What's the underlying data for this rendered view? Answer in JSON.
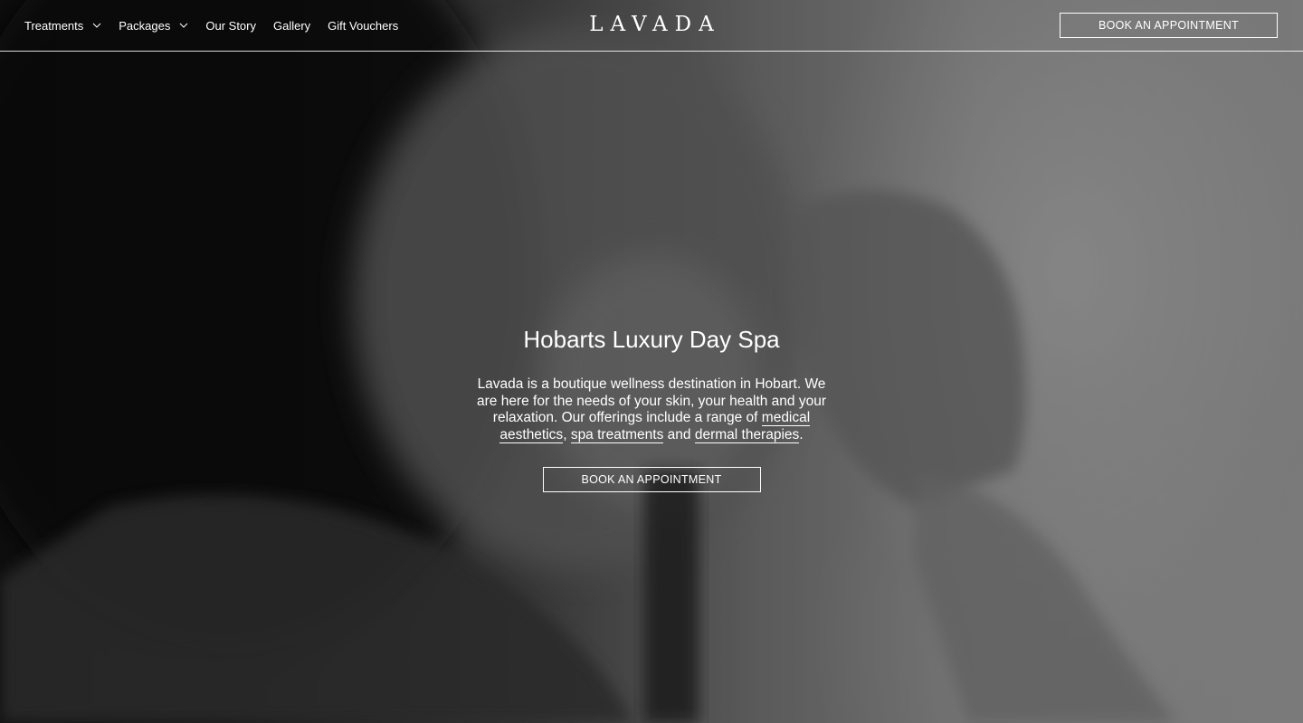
{
  "header": {
    "nav": [
      {
        "label": "Treatments",
        "has_dropdown": true
      },
      {
        "label": "Packages",
        "has_dropdown": true
      },
      {
        "label": "Our Story",
        "has_dropdown": false
      },
      {
        "label": "Gallery",
        "has_dropdown": false
      },
      {
        "label": "Gift Vouchers",
        "has_dropdown": false
      }
    ],
    "logo": "LAVADA",
    "cta_label": "BOOK AN APPOINTMENT",
    "dropdown_icon": "chevron-down-icon"
  },
  "hero": {
    "title": "Hobarts Luxury Day Spa",
    "intro_before_links": "Lavada is a boutique wellness destination in Hobart. We are here for the needs of your skin, your health and your relaxation. Our offerings include a range of ",
    "links": {
      "medical_aesthetics": "medical aesthetics",
      "spa_treatments": "spa treatments",
      "dermal_therapies": "dermal therapies"
    },
    "separator_comma": ", ",
    "separator_and": " and ",
    "end_period": ".",
    "cta_label": "BOOK AN APPOINTMENT"
  },
  "colors": {
    "text": "#ffffff",
    "overlay": "#000000"
  }
}
